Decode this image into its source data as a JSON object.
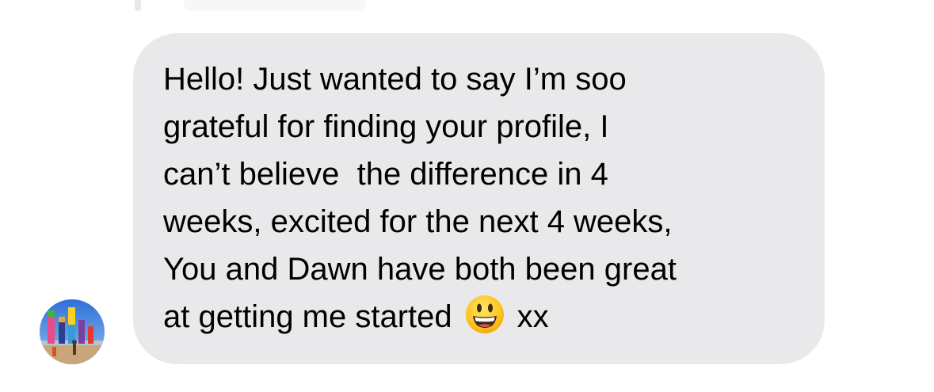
{
  "message": {
    "lines": [
      "Hello! Just wanted to say I’m soo",
      "grateful for finding your profile, I",
      "can’t believe  the difference in 4",
      "weeks, excited for the next 4 weeks,",
      "You and Dawn have both been great"
    ],
    "last_line_before_emoji": "at getting me started",
    "emoji": "grinning-face-with-big-eyes",
    "last_line_after_emoji": "xx"
  },
  "sender": {
    "avatar": "profile-photo"
  },
  "colors": {
    "bubble_background": "#e9e9eb",
    "text": "#000000",
    "page_background": "#ffffff"
  }
}
